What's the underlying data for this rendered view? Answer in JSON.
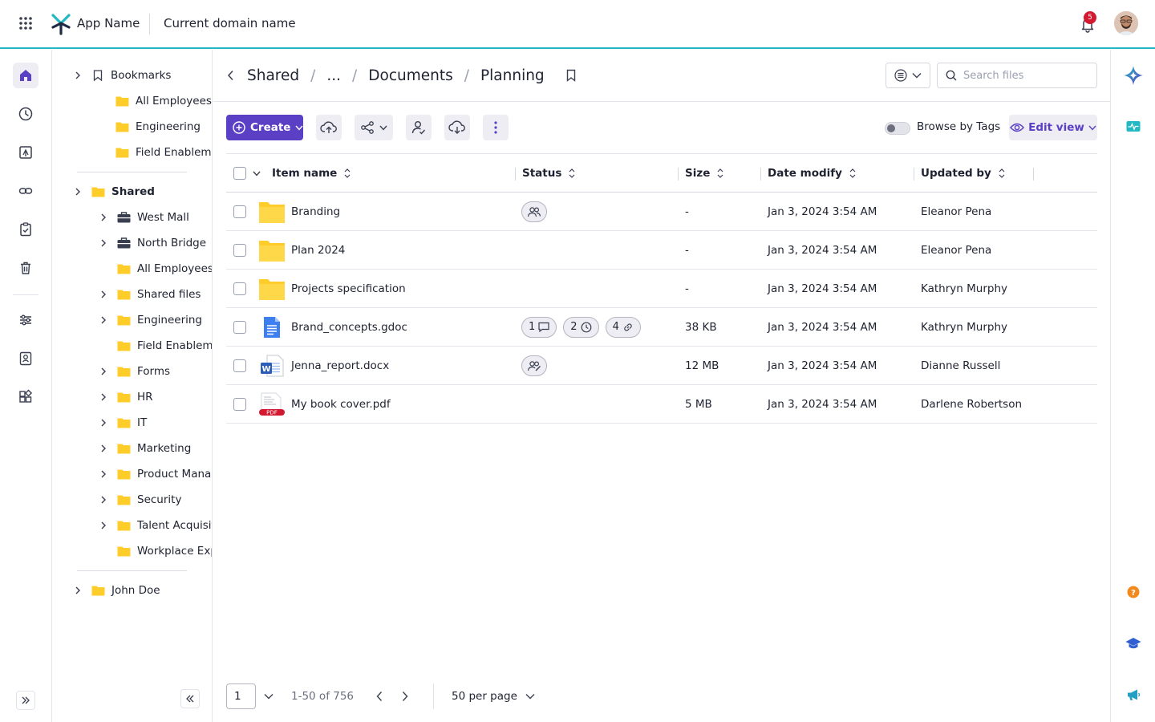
{
  "topbar": {
    "app_name": "App Name",
    "domain_name": "Current domain name",
    "notification_count": "5"
  },
  "breadcrumb": {
    "items": [
      "Shared",
      "...",
      "Documents",
      "Planning"
    ],
    "separator": "/"
  },
  "search": {
    "placeholder": "Search files"
  },
  "toolbar": {
    "create_label": "Create",
    "browse_by_tags_label": "Browse by Tags",
    "browse_by_tags_on": false,
    "edit_view_label": "Edit view"
  },
  "tree": {
    "bookmarks_label": "Bookmarks",
    "bookmarks_children": [
      "All Employees",
      "Engineering",
      "Field Enablement"
    ],
    "shared_label": "Shared",
    "shared_children": [
      {
        "label": "West Mall",
        "icon": "briefcase-icon",
        "expandable": true
      },
      {
        "label": "North Bridge",
        "icon": "briefcase-icon",
        "expandable": true
      },
      {
        "label": "All Employees",
        "icon": "folder-icon",
        "expandable": false
      },
      {
        "label": "Shared files",
        "icon": "folder-icon",
        "expandable": true
      },
      {
        "label": "Engineering",
        "icon": "folder-icon",
        "expandable": true
      },
      {
        "label": "Field Enablement",
        "icon": "folder-icon",
        "expandable": false
      },
      {
        "label": "Forms",
        "icon": "folder-icon",
        "expandable": true
      },
      {
        "label": "HR",
        "icon": "folder-icon",
        "expandable": true
      },
      {
        "label": "IT",
        "icon": "folder-icon",
        "expandable": true
      },
      {
        "label": "Marketing",
        "icon": "folder-icon",
        "expandable": true
      },
      {
        "label": "Product Management",
        "icon": "folder-icon",
        "expandable": true
      },
      {
        "label": "Security",
        "icon": "folder-icon",
        "expandable": true
      },
      {
        "label": "Talent Acquisition",
        "icon": "folder-icon",
        "expandable": true
      },
      {
        "label": "Workplace Experience",
        "icon": "folder-icon",
        "expandable": false
      }
    ],
    "user_label": "John Doe"
  },
  "table": {
    "columns": [
      "Item name",
      "Status",
      "Size",
      "Date modify",
      "Updated by"
    ],
    "rows": [
      {
        "name": "Branding",
        "type": "folder",
        "status": [
          {
            "kind": "shared-icon"
          }
        ],
        "size": "-",
        "date": "Jan 3, 2024 3:54 AM",
        "updated_by": "Eleanor Pena"
      },
      {
        "name": "Plan 2024",
        "type": "folder",
        "status": [],
        "size": "-",
        "date": "Jan 3, 2024 3:54 AM",
        "updated_by": "Eleanor Pena"
      },
      {
        "name": "Projects specification",
        "type": "folder",
        "status": [],
        "size": "-",
        "date": "Jan 3, 2024 3:54 AM",
        "updated_by": "Kathryn Murphy"
      },
      {
        "name": "Brand_concepts.gdoc",
        "type": "gdoc",
        "status": [
          {
            "kind": "comments",
            "count": "1"
          },
          {
            "kind": "versions",
            "count": "2"
          },
          {
            "kind": "links",
            "count": "4"
          }
        ],
        "size": "38 KB",
        "date": "Jan 3, 2024 3:54 AM",
        "updated_by": "Kathryn Murphy"
      },
      {
        "name": "Jenna_report.docx",
        "type": "docx",
        "status": [
          {
            "kind": "shared-edit-icon"
          }
        ],
        "size": "12 MB",
        "date": "Jan 3, 2024 3:54 AM",
        "updated_by": "Dianne Russell"
      },
      {
        "name": "My book cover.pdf",
        "type": "pdf",
        "status": [],
        "size": "5 MB",
        "date": "Jan 3, 2024 3:54 AM",
        "updated_by": "Darlene Robertson"
      }
    ]
  },
  "pagination": {
    "current_page": "1",
    "range_label": "1-50 of 756",
    "per_page_label": "50 per page"
  },
  "colors": {
    "accent": "#5b3fc4",
    "topbar_border": "#22b8c4",
    "folder": "#ffcd29",
    "badge": "#d3182f"
  }
}
